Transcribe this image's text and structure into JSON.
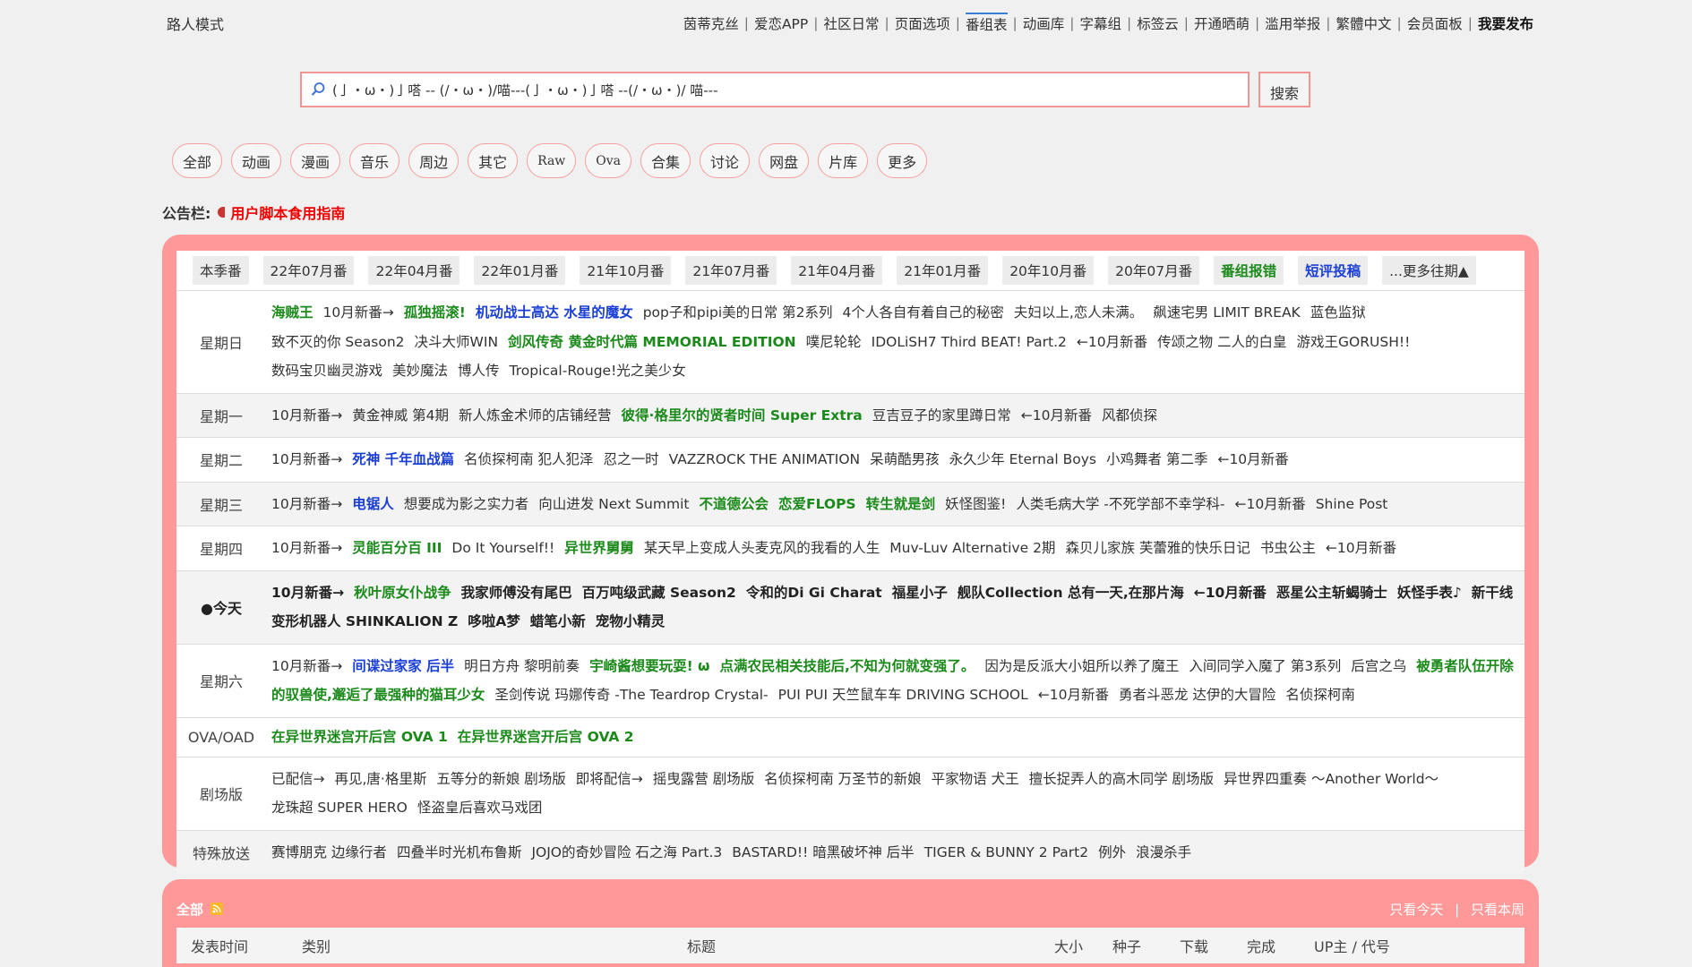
{
  "header": {
    "guest_mode": "路人模式",
    "nav": [
      "茵蒂克丝",
      "爱恋APP",
      "社区日常",
      "页面选项",
      "番组表",
      "动画库",
      "字幕组",
      "标签云",
      "开通晒萌",
      "滥用举报",
      "繁體中文",
      "会员面板",
      "我要发布"
    ]
  },
  "search": {
    "value": "(亅・ω・)亅嗒 -- (/・ω・)/喵---(亅・ω・)亅嗒 --(/・ω・)/ 喵---",
    "button": "搜索"
  },
  "categories": [
    "全部",
    "动画",
    "漫画",
    "音乐",
    "周边",
    "其它",
    "Raw",
    "Ova",
    "合集",
    "讨论",
    "网盘",
    "片库",
    "更多"
  ],
  "notice": {
    "label": "公告栏:",
    "link": "用户脚本食用指南"
  },
  "schedule": {
    "tabs": [
      "本季番",
      "22年07月番",
      "22年04月番",
      "22年01月番",
      "21年10月番",
      "21年07月番",
      "21年04月番",
      "21年01月番",
      "20年10月番",
      "20年07月番",
      "番组报错",
      "短评投稿",
      "...更多往期▲"
    ],
    "rows": [
      {
        "day": "星期日",
        "items": [
          {
            "t": "海贼王",
            "c": "g"
          },
          {
            "t": "10月新番→",
            "c": ""
          },
          {
            "t": "孤独摇滚!",
            "c": "g"
          },
          {
            "t": "机动战士高达 水星的魔女",
            "c": "b"
          },
          {
            "t": "pop子和pipi美的日常 第2系列",
            "c": ""
          },
          {
            "t": "4个人各自有着自己的秘密",
            "c": ""
          },
          {
            "t": "夫妇以上,恋人未满。",
            "c": ""
          },
          {
            "t": "飙速宅男 LIMIT BREAK",
            "c": ""
          },
          {
            "t": "蓝色监狱",
            "c": ""
          },
          {
            "t": "致不灭的你 Season2",
            "c": ""
          },
          {
            "t": "决斗大师WIN",
            "c": ""
          },
          {
            "t": "剑风传奇 黄金时代篇 MEMORIAL EDITION",
            "c": "g"
          },
          {
            "t": "噗尼轮轮",
            "c": ""
          },
          {
            "t": "IDOLiSH7 Third BEAT! Part.2",
            "c": ""
          },
          {
            "t": "←10月新番",
            "c": ""
          },
          {
            "t": "传颂之物 二人的白皇",
            "c": ""
          },
          {
            "t": "游戏王GORUSH!!",
            "c": ""
          },
          {
            "t": "数码宝贝幽灵游戏",
            "c": ""
          },
          {
            "t": "美妙魔法",
            "c": ""
          },
          {
            "t": "博人传",
            "c": ""
          },
          {
            "t": "Tropical-Rouge!光之美少女",
            "c": ""
          }
        ]
      },
      {
        "day": "星期一",
        "items": [
          {
            "t": "10月新番→",
            "c": ""
          },
          {
            "t": "黄金神威 第4期",
            "c": ""
          },
          {
            "t": "新人炼金术师的店铺经营",
            "c": ""
          },
          {
            "t": "彼得·格里尔的贤者时间 Super Extra",
            "c": "g"
          },
          {
            "t": "豆吉豆子的家里蹲日常",
            "c": ""
          },
          {
            "t": "←10月新番",
            "c": ""
          },
          {
            "t": "风都侦探",
            "c": ""
          }
        ]
      },
      {
        "day": "星期二",
        "items": [
          {
            "t": "10月新番→",
            "c": ""
          },
          {
            "t": "死神 千年血战篇",
            "c": "b"
          },
          {
            "t": "名侦探柯南 犯人犯泽",
            "c": ""
          },
          {
            "t": "忍之一时",
            "c": ""
          },
          {
            "t": "VAZZROCK THE ANIMATION",
            "c": ""
          },
          {
            "t": "呆萌酷男孩",
            "c": ""
          },
          {
            "t": "永久少年 Eternal Boys",
            "c": ""
          },
          {
            "t": "小鸡舞者 第二季",
            "c": ""
          },
          {
            "t": "←10月新番",
            "c": ""
          }
        ]
      },
      {
        "day": "星期三",
        "items": [
          {
            "t": "10月新番→",
            "c": ""
          },
          {
            "t": "电锯人",
            "c": "b"
          },
          {
            "t": "想要成为影之实力者",
            "c": ""
          },
          {
            "t": "向山进发 Next Summit",
            "c": ""
          },
          {
            "t": "不道德公会",
            "c": "g"
          },
          {
            "t": "恋爱FLOPS",
            "c": "g"
          },
          {
            "t": "转生就是剑",
            "c": "g"
          },
          {
            "t": "妖怪图鉴!",
            "c": ""
          },
          {
            "t": "人类毛病大学 -不死学部不幸学科-",
            "c": ""
          },
          {
            "t": "←10月新番",
            "c": ""
          },
          {
            "t": "Shine Post",
            "c": ""
          }
        ]
      },
      {
        "day": "星期四",
        "items": [
          {
            "t": "10月新番→",
            "c": ""
          },
          {
            "t": "灵能百分百 III",
            "c": "g"
          },
          {
            "t": "Do It Yourself!!",
            "c": ""
          },
          {
            "t": "异世界舅舅",
            "c": "g"
          },
          {
            "t": "某天早上变成人头麦克风的我看的人生",
            "c": ""
          },
          {
            "t": "Muv-Luv Alternative 2期",
            "c": ""
          },
          {
            "t": "森贝儿家族 芙蕾雅的快乐日记",
            "c": ""
          },
          {
            "t": "书虫公主",
            "c": ""
          },
          {
            "t": "←10月新番",
            "c": ""
          }
        ]
      },
      {
        "day": "●今天",
        "items": [
          {
            "t": "10月新番→",
            "c": ""
          },
          {
            "t": "秋叶原女仆战争",
            "c": "g"
          },
          {
            "t": "我家师傅没有尾巴",
            "c": ""
          },
          {
            "t": "百万吨级武藏 Season2",
            "c": ""
          },
          {
            "t": "令和的Di Gi Charat",
            "c": ""
          },
          {
            "t": "福星小子",
            "c": ""
          },
          {
            "t": "舰队Collection 总有一天,在那片海",
            "c": ""
          },
          {
            "t": "←10月新番",
            "c": ""
          },
          {
            "t": "恶星公主斩蝎骑士",
            "c": ""
          },
          {
            "t": "妖怪手表♪",
            "c": ""
          },
          {
            "t": "新干线变形机器人 SHINKALION Z",
            "c": ""
          },
          {
            "t": "哆啦A梦",
            "c": ""
          },
          {
            "t": "蜡笔小新",
            "c": ""
          },
          {
            "t": "宠物小精灵",
            "c": ""
          }
        ]
      },
      {
        "day": "星期六",
        "items": [
          {
            "t": "10月新番→",
            "c": ""
          },
          {
            "t": "间谍过家家 后半",
            "c": "b"
          },
          {
            "t": "明日方舟 黎明前奏",
            "c": ""
          },
          {
            "t": "宇崎酱想要玩耍! ω",
            "c": "g"
          },
          {
            "t": "点满农民相关技能后,不知为何就变强了。",
            "c": "g"
          },
          {
            "t": "因为是反派大小姐所以养了魔王",
            "c": ""
          },
          {
            "t": "入间同学入魔了 第3系列",
            "c": ""
          },
          {
            "t": "后宫之乌",
            "c": ""
          },
          {
            "t": "被勇者队伍开除的驭兽使,邂逅了最强种的猫耳少女",
            "c": "g"
          },
          {
            "t": "圣剑传说 玛娜传奇 -The Teardrop Crystal-",
            "c": ""
          },
          {
            "t": "PUI PUI 天竺鼠车车 DRIVING SCHOOL",
            "c": ""
          },
          {
            "t": "←10月新番",
            "c": ""
          },
          {
            "t": "勇者斗恶龙 达伊的大冒险",
            "c": ""
          },
          {
            "t": "名侦探柯南",
            "c": ""
          }
        ]
      },
      {
        "day": "OVA/OAD",
        "items": [
          {
            "t": "在异世界迷宫开后宫 OVA 1",
            "c": "g"
          },
          {
            "t": "在异世界迷宫开后宫 OVA 2",
            "c": "g"
          }
        ]
      },
      {
        "day": "剧场版",
        "items": [
          {
            "t": "已配信→",
            "c": ""
          },
          {
            "t": "再见,唐·格里斯",
            "c": ""
          },
          {
            "t": "五等分的新娘 剧场版",
            "c": ""
          },
          {
            "t": "即将配信→",
            "c": ""
          },
          {
            "t": "摇曳露营 剧场版",
            "c": ""
          },
          {
            "t": "名侦探柯南 万圣节的新娘",
            "c": ""
          },
          {
            "t": "平家物语 犬王",
            "c": ""
          },
          {
            "t": "擅长捉弄人的高木同学 剧场版",
            "c": ""
          },
          {
            "t": "异世界四重奏 ～Another World～",
            "c": ""
          },
          {
            "t": "龙珠超 SUPER HERO",
            "c": ""
          },
          {
            "t": "怪盗皇后喜欢马戏团",
            "c": ""
          }
        ]
      },
      {
        "day": "特殊放送",
        "items": [
          {
            "t": "赛博朋克 边缘行者",
            "c": ""
          },
          {
            "t": "四叠半时光机布鲁斯",
            "c": ""
          },
          {
            "t": "JOJO的奇妙冒险 石之海 Part.3",
            "c": ""
          },
          {
            "t": "BASTARD!! 暗黑破坏神 后半",
            "c": ""
          },
          {
            "t": "TIGER & BUNNY 2 Part2",
            "c": ""
          },
          {
            "t": "例外",
            "c": ""
          },
          {
            "t": "浪漫杀手",
            "c": ""
          }
        ]
      }
    ]
  },
  "torrents": {
    "title": "全部",
    "links": [
      "只看今天",
      "只看本周"
    ],
    "columns": [
      "发表时间",
      "类别",
      "标题",
      "大小",
      "种子",
      "下载",
      "完成",
      "UP主 / 代号"
    ]
  },
  "colors": {
    "accent": "#ff9898",
    "green": "#1b8a1b",
    "blue": "#1b3fd4",
    "notice": "#e00000"
  }
}
